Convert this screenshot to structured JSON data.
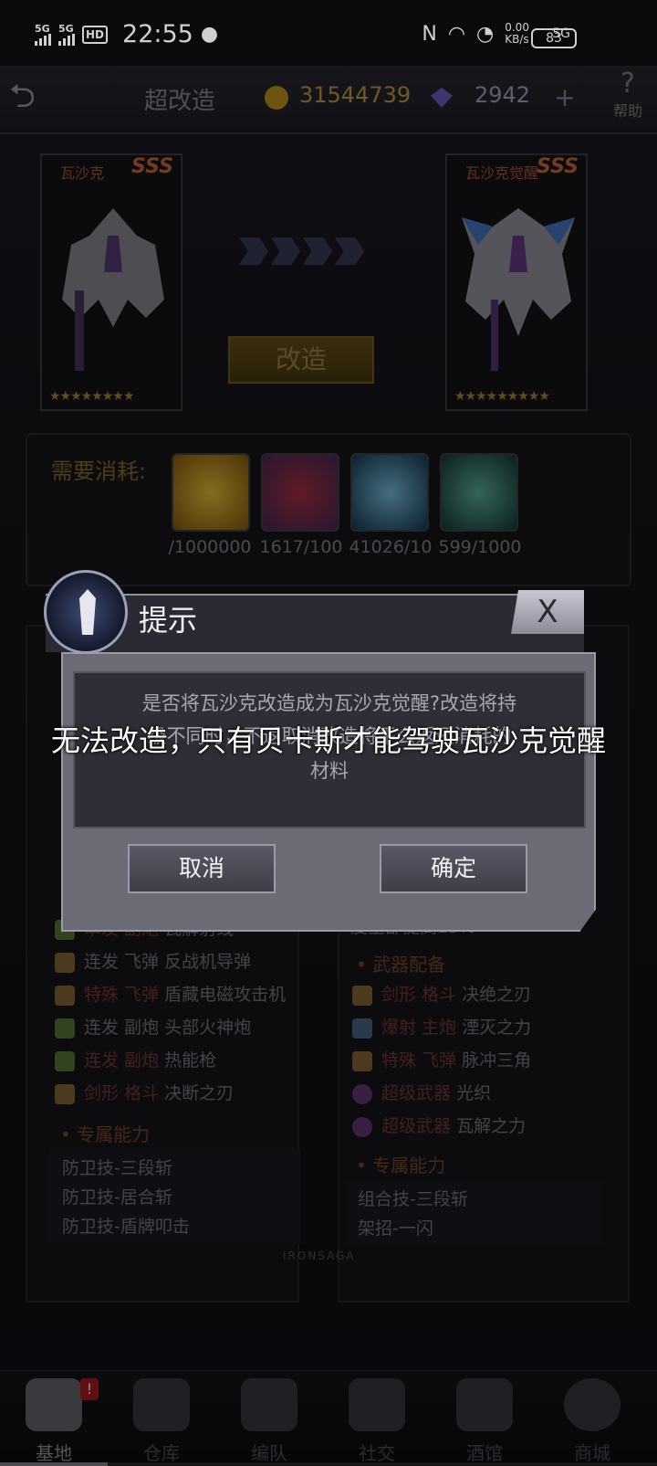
{
  "status": {
    "time": "22:55",
    "net_speed": "0.00 KB/s",
    "battery": "83",
    "sig1": "5G",
    "sig2": "5G",
    "hd": "HD",
    "sim": "5G"
  },
  "header": {
    "title": "超改造",
    "gold": "31544739",
    "gems": "2942",
    "plus": "+",
    "help": "帮助",
    "help_q": "?"
  },
  "cards": {
    "left": {
      "name": "瓦沙克",
      "rank": "SSS",
      "stars": "★★★★★★★★"
    },
    "right": {
      "name": "瓦沙克觉醒",
      "rank": "SSS",
      "stars": "★★★★★★★★★"
    }
  },
  "modify_label": "改造",
  "materials": {
    "label": "需要消耗:",
    "counts": [
      "/1000000",
      "1617/100",
      "41026/10",
      "599/1000"
    ]
  },
  "left_panel": {
    "rows": [
      {
        "kind": "单发 副炮",
        "name": "瓦解射线"
      },
      {
        "kind": "连发 飞弹",
        "name": "反战机导弹"
      },
      {
        "kind": "特殊 飞弹",
        "name": "盾藏电磁攻击机"
      },
      {
        "kind": "连发 副炮",
        "name": "头部火神炮"
      },
      {
        "kind": "连发 副炮",
        "name": "热能枪"
      },
      {
        "kind": "剑形 格斗",
        "name": "决断之刃"
      }
    ],
    "section": "专属能力",
    "abilities": [
      "防卫技-三段斩",
      "防卫技-居合斩",
      "防卫技-盾牌叩击"
    ]
  },
  "right_panel": {
    "top_text": "度全部提高15%",
    "weapon_section": "武器配备",
    "rows": [
      {
        "kind": "剑形 格斗",
        "name": "决绝之刃"
      },
      {
        "kind": "爆射 主炮",
        "name": "湮灭之力"
      },
      {
        "kind": "特殊 飞弹",
        "name": "脉冲三角"
      },
      {
        "kind": "超级武器",
        "name": "光织"
      },
      {
        "kind": "超级武器",
        "name": "瓦解之力"
      }
    ],
    "section": "专属能力",
    "abilities": [
      "组合技-三段斩",
      "架招-一闪"
    ]
  },
  "brand": "IRONSAGA",
  "nav": [
    {
      "label": "基地",
      "badge": "!"
    },
    {
      "label": "仓库"
    },
    {
      "label": "编队"
    },
    {
      "label": "社交"
    },
    {
      "label": "酒馆"
    },
    {
      "label": "商城"
    }
  ],
  "dialog": {
    "title": "提示",
    "close": "X",
    "message_line1": "是否将瓦沙克改造成为瓦沙克觉醒?改造将持",
    "message_line2": "级不同时，不返取消改造将平么返还消耗的",
    "message_line3": "材料",
    "cancel": "取消",
    "confirm": "确定"
  },
  "toast": "无法改造，只有贝卡斯才能驾驶瓦沙克觉醒",
  "colors": {
    "gold": "#c9a24a",
    "accent_orange": "#d46e3a",
    "dialog_bg": "#6b6b76"
  }
}
